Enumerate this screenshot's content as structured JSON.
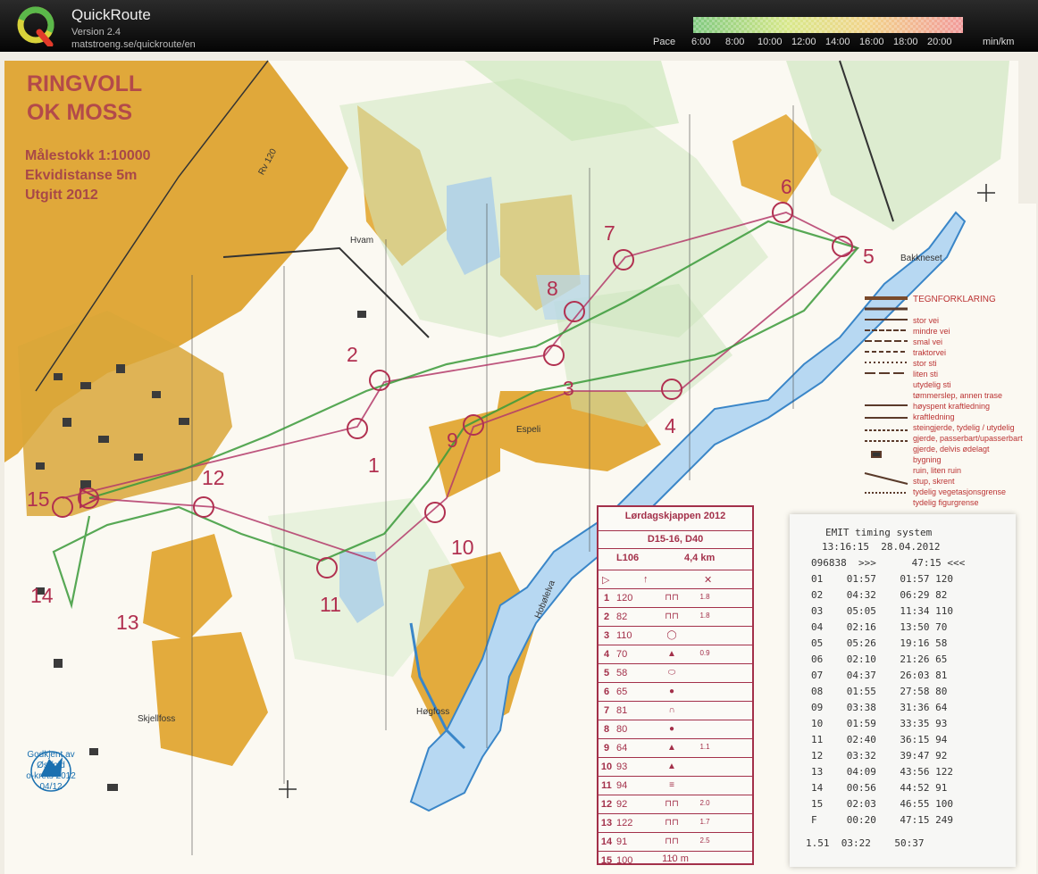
{
  "app": {
    "title": "QuickRoute",
    "version": "Version 2.4",
    "url": "matstroeng.se/quickroute/en",
    "pace_label": "Pace",
    "pace_ticks": [
      "6:00",
      "8:00",
      "10:00",
      "12:00",
      "14:00",
      "16:00",
      "18:00",
      "20:00"
    ],
    "pace_unit": "min/km",
    "pace_colors": [
      "#7fc97f",
      "#d8e88a",
      "#f2d38a",
      "#f29a9a"
    ]
  },
  "map": {
    "club_line1": "RINGVOLL",
    "club_line2": "OK MOSS",
    "scale": "Målestokk  1:10000",
    "contour": "Ekvidistanse  5m",
    "published": "Utgitt      2012",
    "road_label": "Rv 120",
    "places": {
      "hvam": "Hvam",
      "espeli": "Espeli",
      "bakkneset": "Bakkneset",
      "hobolelva": "Hobølelva",
      "hogfoss": "Høgfoss",
      "skjellfoss": "Skjellfoss"
    },
    "controls": [
      "1",
      "2",
      "3",
      "4",
      "5",
      "6",
      "7",
      "8",
      "9",
      "10",
      "11",
      "12",
      "13",
      "14",
      "15"
    ],
    "legend": {
      "title": "TEGNFORKLARING",
      "items": [
        "stor vei",
        "mindre vei",
        "smal vei",
        "traktorvei",
        "stor sti",
        "liten sti",
        "utydelig sti",
        "tømmerslep, annen trase",
        "høyspent kraftledning",
        "kraftledning",
        "steingjerde, tydelig / utydelig",
        "gjerde, passerbart/upasserbart",
        "gjerde, delvis ødelagt",
        "bygning",
        "ruin, liten ruin",
        "stup, skrent",
        "tydelig vegetasjonsgrense",
        "tydelig figurgrense"
      ]
    },
    "approved": {
      "line1": "Godkjent av",
      "line2": "Østfold",
      "line3": "o-krets 2012",
      "line4": "04/12"
    }
  },
  "description_card": {
    "event": "Lørdagskjappen 2012",
    "classes": "D15-16, D40",
    "course": "L106",
    "length": "4,4 km",
    "rows": [
      {
        "n": "1",
        "code": "120",
        "sym": "⊓⊓",
        "size": "1.8"
      },
      {
        "n": "2",
        "code": "82",
        "sym": "⊓⊓",
        "size": "1.8"
      },
      {
        "n": "3",
        "code": "110",
        "sym": "◯",
        "size": ""
      },
      {
        "n": "4",
        "code": "70",
        "sym": "▲",
        "size": "0.9"
      },
      {
        "n": "5",
        "code": "58",
        "sym": "⬭",
        "size": ""
      },
      {
        "n": "6",
        "code": "65",
        "sym": "●",
        "size": ""
      },
      {
        "n": "7",
        "code": "81",
        "sym": "∩",
        "size": ""
      },
      {
        "n": "8",
        "code": "80",
        "sym": "●",
        "size": ""
      },
      {
        "n": "9",
        "code": "64",
        "sym": "▲",
        "size": "1.1"
      },
      {
        "n": "10",
        "code": "93",
        "sym": "▲",
        "size": ""
      },
      {
        "n": "11",
        "code": "94",
        "sym": "≡",
        "size": ""
      },
      {
        "n": "12",
        "code": "92",
        "sym": "⊓⊓",
        "size": "2.0"
      },
      {
        "n": "13",
        "code": "122",
        "sym": "⊓⊓",
        "size": "1.7"
      },
      {
        "n": "14",
        "code": "91",
        "sym": "⊓⊓",
        "size": "2.5"
      },
      {
        "n": "15",
        "code": "100",
        "sym": "∴",
        "size": ""
      }
    ],
    "footer": "110 m"
  },
  "emit_slip": {
    "title": "EMIT timing system",
    "datetime": "13:16:15  28.04.2012",
    "card_line": "096838  >>>      47:15 <<<",
    "splits": [
      "01    01:57    01:57 120",
      "02    04:32    06:29 82",
      "03    05:05    11:34 110",
      "04    02:16    13:50 70",
      "05    05:26    19:16 58",
      "06    02:10    21:26 65",
      "07    04:37    26:03 81",
      "08    01:55    27:58 80",
      "09    03:38    31:36 64",
      "10    01:59    33:35 93",
      "11    02:40    36:15 94",
      "12    03:32    39:47 92",
      "13    04:09    43:56 122",
      "14    00:56    44:52 91",
      "15    02:03    46:55 100",
      "F     00:20    47:15 249"
    ],
    "footer": "1.51  03:22    50:37"
  }
}
